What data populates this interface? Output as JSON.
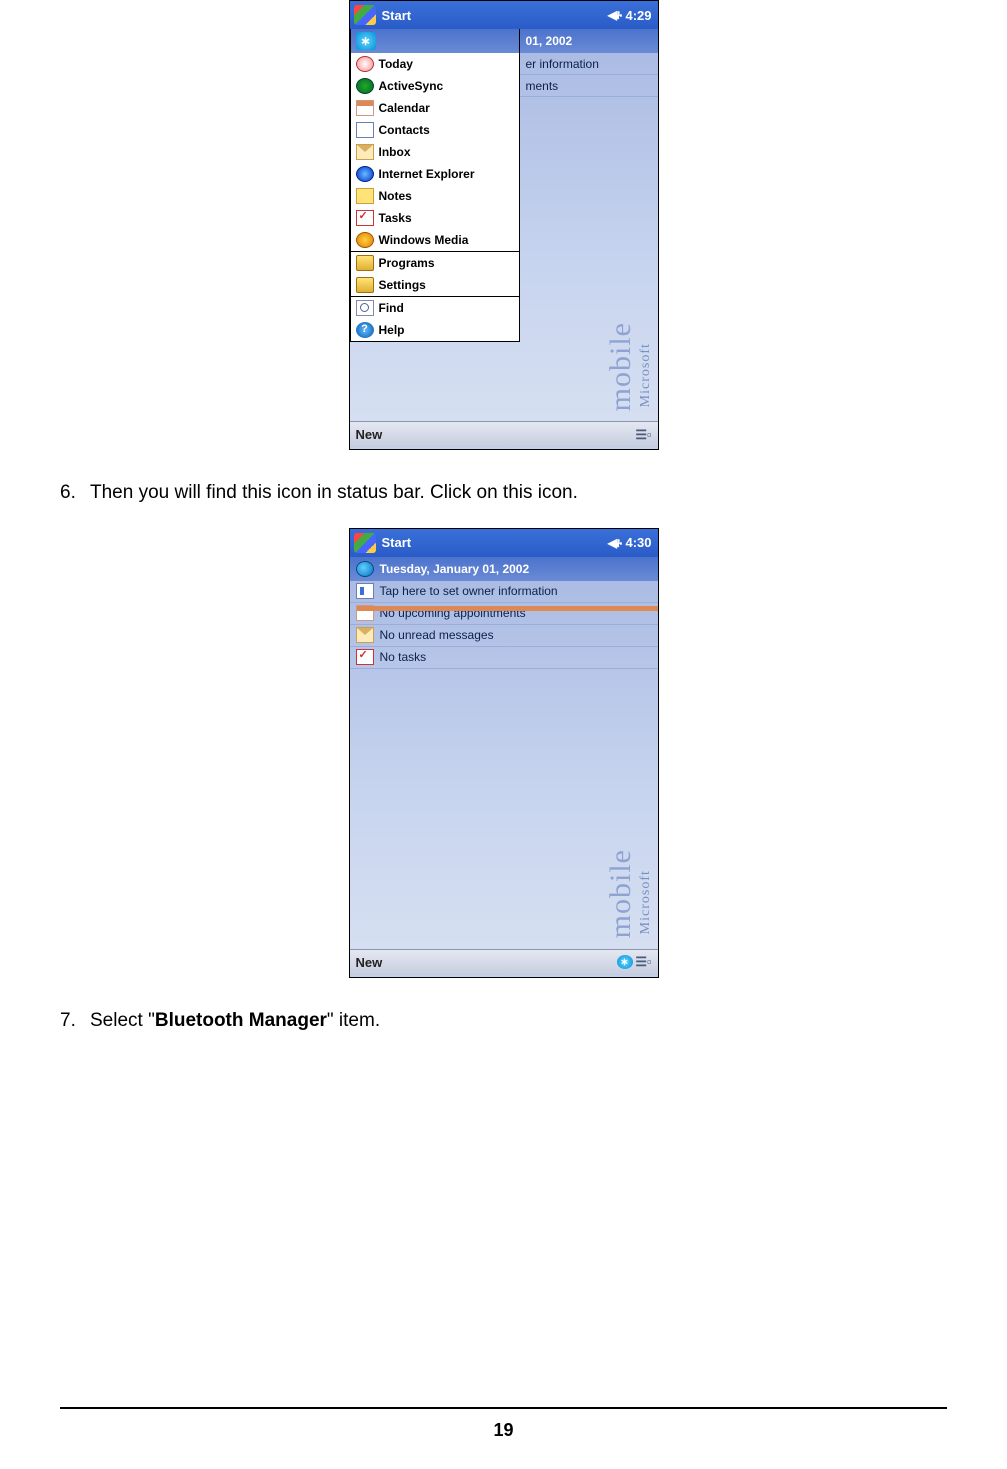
{
  "steps": {
    "s6": {
      "num": "6.",
      "text": "Then you will find this icon in status bar. Click on this icon."
    },
    "s7": {
      "num": "7.",
      "pre": "Select \"",
      "bold": "Bluetooth Manager",
      "post": "\" item."
    }
  },
  "device1": {
    "title": "Start",
    "time": "4:29",
    "rightDate": "01, 2002",
    "rightOwnerFrag": "er information",
    "rightApptFrag": "ments",
    "bottomNew": "New",
    "menu": [
      {
        "label": "Today",
        "icon": "ico-home"
      },
      {
        "label": "ActiveSync",
        "icon": "ico-sync"
      },
      {
        "label": "Calendar",
        "icon": "ico-cal"
      },
      {
        "label": "Contacts",
        "icon": "ico-contacts"
      },
      {
        "label": "Inbox",
        "icon": "ico-mail"
      },
      {
        "label": "Internet Explorer",
        "icon": "ico-ie"
      },
      {
        "label": "Notes",
        "icon": "ico-notes"
      },
      {
        "label": "Tasks",
        "icon": "ico-task"
      },
      {
        "label": "Windows Media",
        "icon": "ico-media"
      }
    ],
    "menu2": [
      {
        "label": "Programs",
        "icon": "ico-folder"
      },
      {
        "label": "Settings",
        "icon": "ico-folder"
      }
    ],
    "menu3": [
      {
        "label": "Find",
        "icon": "ico-find"
      },
      {
        "label": "Help",
        "icon": "ico-help",
        "glyph": "?"
      }
    ],
    "brandBig": "mobile",
    "brandSmall": "Microsoft"
  },
  "device2": {
    "title": "Start",
    "time": "4:30",
    "today": [
      {
        "label": "Tuesday, January 01, 2002",
        "icon": "ico-globe",
        "header": true
      },
      {
        "label": "Tap here to set owner information",
        "icon": "ico-owner"
      },
      {
        "label": "No upcoming appointments",
        "icon": "ico-cal"
      },
      {
        "label": "No unread messages",
        "icon": "ico-mail"
      },
      {
        "label": "No tasks",
        "icon": "ico-task"
      }
    ],
    "bottomNew": "New",
    "brandBig": "mobile",
    "brandSmall": "Microsoft"
  },
  "pageNumber": "19"
}
